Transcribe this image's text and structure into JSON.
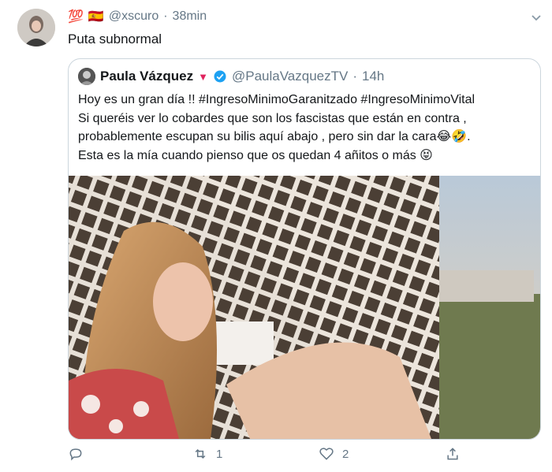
{
  "tweet": {
    "emoji_badge": "💯",
    "flag": "🇪🇸",
    "handle": "@xscuro",
    "separator": "·",
    "time": "38min",
    "text": "Puta subnormal"
  },
  "quoted": {
    "name": "Paula Vázquez",
    "triangle": "▼",
    "handle": "@PaulaVazquezTV",
    "separator": "·",
    "time": "14h",
    "lines": [
      "Hoy es un gran día !! #IngresoMinimoGaranitzado #IngresoMinimoVital",
      "Si queréis ver lo cobardes que son los fascistas que están en contra ,",
      "probablemente escupan su bilis aquí abajo , pero sin dar la cara😂🤣.",
      "Esta es la mía cuando pienso que os quedan 4 añitos o más 😝"
    ]
  },
  "actions": {
    "reply_count": "",
    "retweet_count": "1",
    "like_count": "2"
  },
  "colors": {
    "accent": "#1da1f2",
    "muted": "#657786",
    "border": "#ccd6dd"
  }
}
